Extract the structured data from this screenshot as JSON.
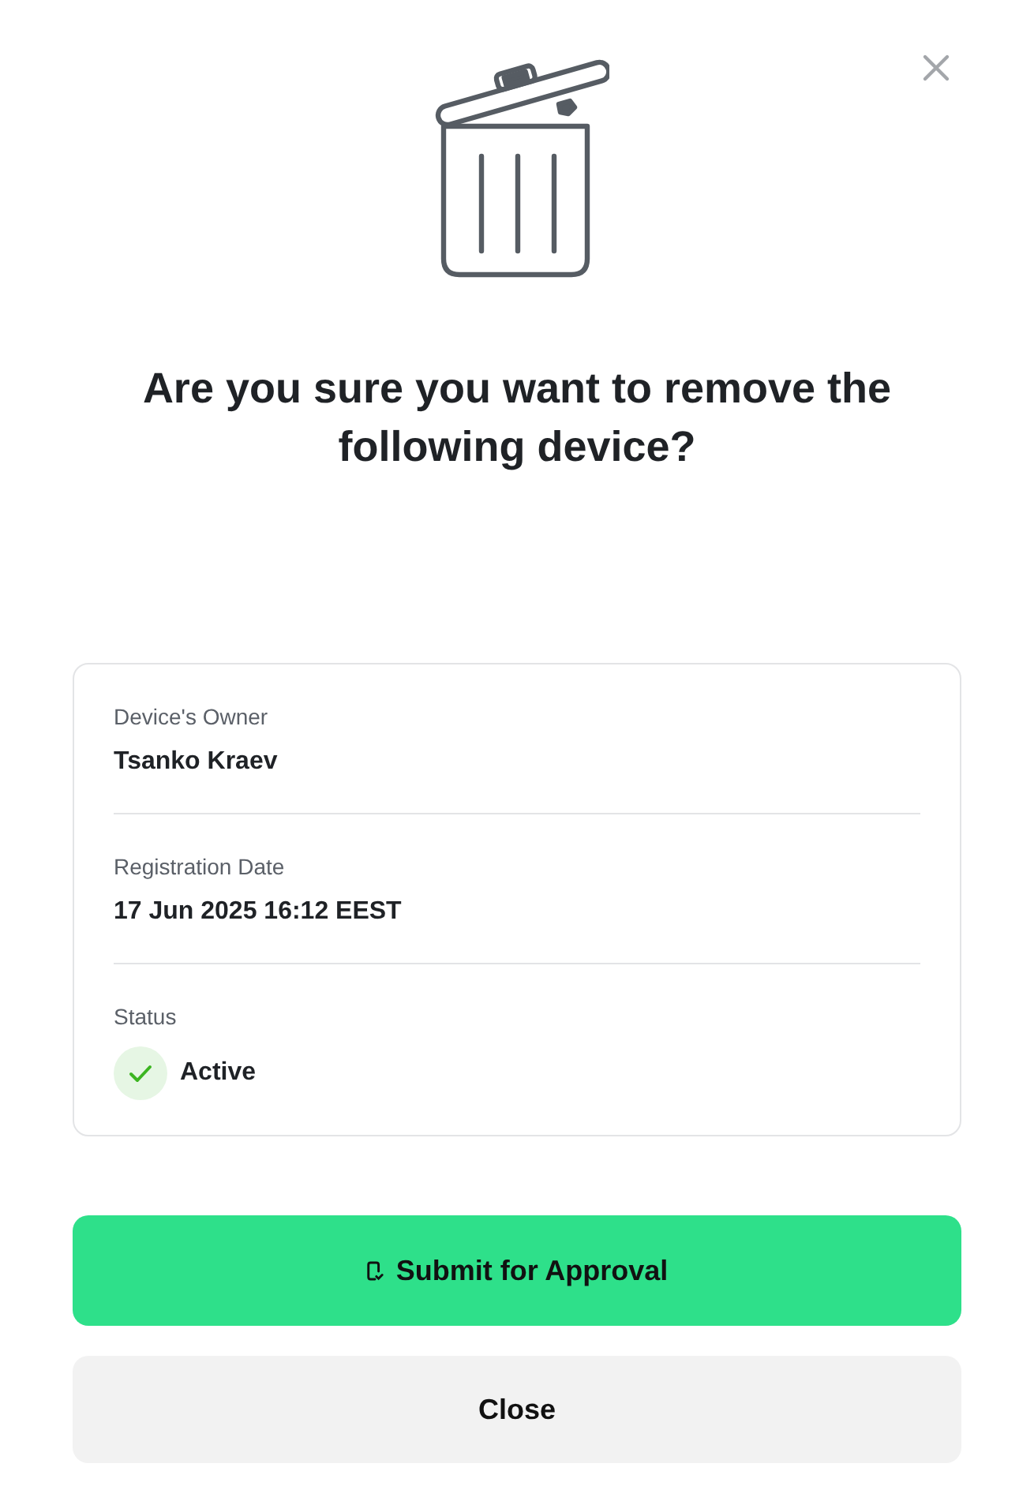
{
  "title": "Are you sure you want to remove the following device?",
  "details": [
    {
      "kind": "text",
      "label": "Device's Owner",
      "value": "Tsanko Kraev"
    },
    {
      "kind": "text",
      "label": "Registration Date",
      "value": "17 Jun 2025 16:12 EEST"
    },
    {
      "kind": "status",
      "label": "Status",
      "value": "Active"
    }
  ],
  "buttons": [
    {
      "kind": "primary",
      "label": "Submit for Approval"
    },
    {
      "kind": "secondary",
      "label": "Close"
    }
  ]
}
